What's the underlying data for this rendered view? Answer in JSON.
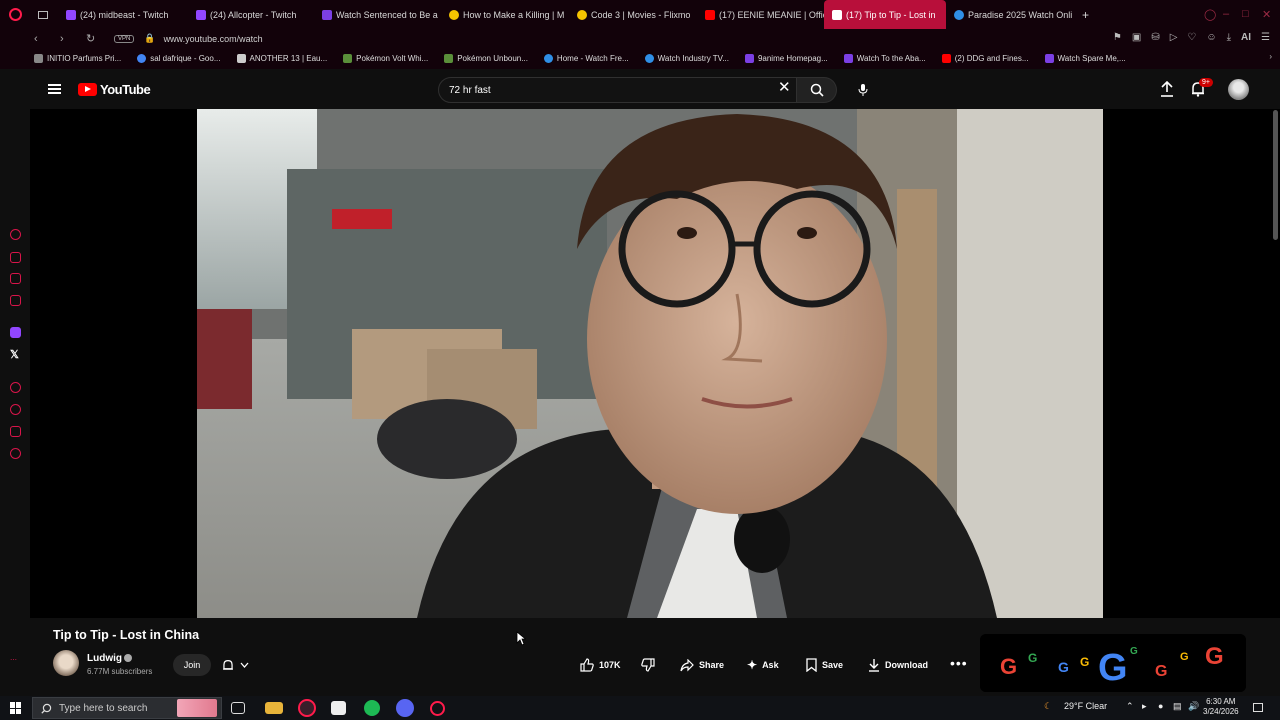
{
  "browser": {
    "tabs": [
      {
        "label": "(24) midbeast - Twitch",
        "color": "#9146ff"
      },
      {
        "label": "(24) Allcopter - Twitch",
        "color": "#9146ff"
      },
      {
        "label": "Watch Sentenced to Be a",
        "color": "#7b3fe4"
      },
      {
        "label": "How to Make a Killing | M",
        "color": "#f5c400"
      },
      {
        "label": "Code 3 | Movies - Flixmo",
        "color": "#f5c400"
      },
      {
        "label": "(17) EENIE MEANIE | Offic",
        "color": "#ff0000"
      },
      {
        "label": "(17) Tip to Tip - Lost in",
        "color": "#ff0000",
        "active": true
      },
      {
        "label": "Paradise 2025 Watch Onli",
        "color": "#2f8fe6"
      }
    ],
    "new_tab": "+",
    "url": "www.youtube.com/watch",
    "vpn_label": "VPN",
    "ai_label": "AI",
    "bookmarks": [
      {
        "label": "INITIO Parfums Pri...",
        "color": "#888"
      },
      {
        "label": "sal dafrique - Goo...",
        "color": "#4285f4"
      },
      {
        "label": "ANOTHER 13 | Eau...",
        "color": "#ccc"
      },
      {
        "label": "Pokémon Volt Whi...",
        "color": "#5a8f3a"
      },
      {
        "label": "Pokémon Unboun...",
        "color": "#5a8f3a"
      },
      {
        "label": "Home - Watch Fre...",
        "color": "#2f8fe6"
      },
      {
        "label": "Watch Industry TV...",
        "color": "#2f8fe6"
      },
      {
        "label": "9anime Homepag...",
        "color": "#7b3fe4"
      },
      {
        "label": "Watch To the Aba...",
        "color": "#7b3fe4"
      },
      {
        "label": "(2) DDG and Fines...",
        "color": "#ff0000"
      },
      {
        "label": "Watch Spare Me,...",
        "color": "#7b3fe4"
      }
    ]
  },
  "youtube": {
    "logo_text": "YouTube",
    "search_value": "72 hr fast",
    "notification_count": "9+",
    "video": {
      "title": "Tip to Tip - Lost in China",
      "channel": "Ludwig",
      "subscribers": "6.77M subscribers",
      "join_label": "Join",
      "likes": "107K",
      "share_label": "Share",
      "ask_label": "Ask",
      "save_label": "Save",
      "download_label": "Download"
    }
  },
  "taskbar": {
    "search_placeholder": "Type here to search",
    "weather": "29°F  Clear",
    "time": "6:30 AM",
    "date": "3/24/2026"
  }
}
